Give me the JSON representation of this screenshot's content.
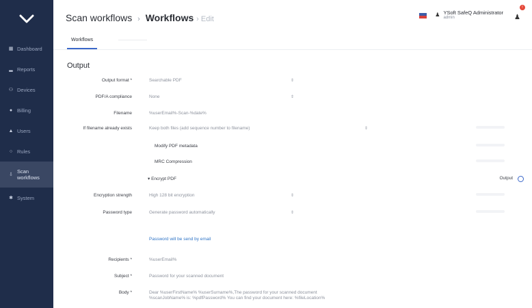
{
  "sidebar": {
    "items": [
      {
        "icon": "▦",
        "label": "Dashboard"
      },
      {
        "icon": "▂",
        "label": "Reports"
      },
      {
        "icon": "⚇",
        "label": "Devices"
      },
      {
        "icon": "●",
        "label": "Billing"
      },
      {
        "icon": "▲",
        "label": "Users"
      },
      {
        "icon": "○",
        "label": "Rules"
      },
      {
        "icon": "⇩",
        "label": "Scan workflows"
      },
      {
        "icon": "✱",
        "label": "System"
      }
    ]
  },
  "header": {
    "crumb_root": "Scan workflows",
    "crumb_sep": "›",
    "crumb_current": "Workflows",
    "crumb_tail": "› Edit",
    "user_name": "YSoft SafeQ Administrator",
    "user_role": "admin",
    "notifications": "!"
  },
  "tabs": {
    "active": "Workflows"
  },
  "form": {
    "section_title": "Output",
    "output_format": {
      "label": "Output format *",
      "value": "Searchable PDF"
    },
    "pdfa": {
      "label": "PDF/A compliance",
      "value": "None"
    },
    "filename": {
      "label": "Filename",
      "value": "%userEmail%-Scan-%date%"
    },
    "if_exists": {
      "label": "If filename already exists",
      "value": "Keep both files (add sequence number to filename)"
    },
    "modify_pdf": "Modify PDF metadata",
    "mrc": "MRC Compression",
    "encrypt": "Encrypt PDF",
    "output_right": "Output",
    "enc_strength": {
      "label": "Encryption strength",
      "value": "High 128 bit encryption"
    },
    "password_type": {
      "label": "Password type",
      "value": "Generate password automatically"
    },
    "password_note": "Password will be send by email",
    "recipients": {
      "label": "Recipients *",
      "value": "%userEmail%"
    },
    "subject": {
      "label": "Subject *",
      "value": "Password for your scanned document"
    },
    "body": {
      "label": "Body *",
      "value": "Dear %userFirstName% %userSurname%,The password for your scanned document %scanJobName% is: %pdfPassword% You can find your document here: %fileLocation%"
    }
  }
}
